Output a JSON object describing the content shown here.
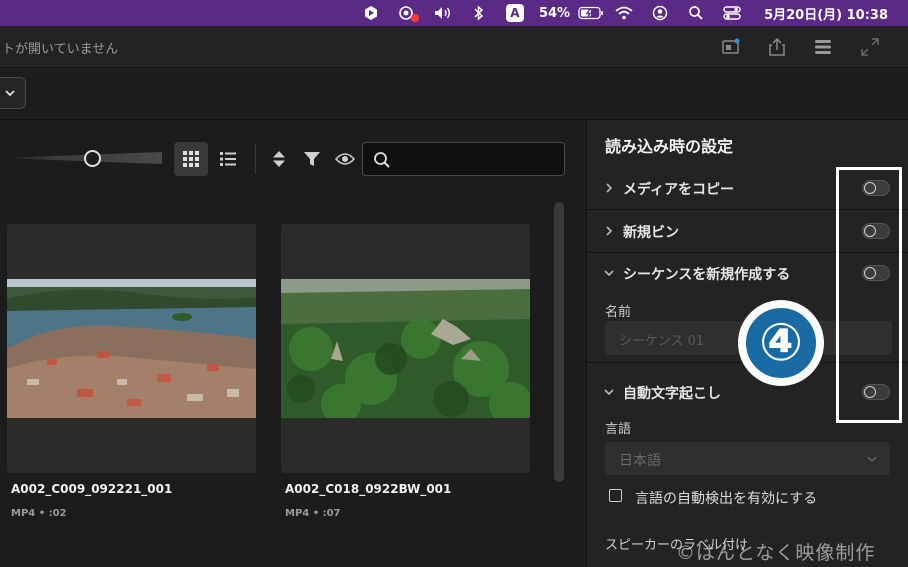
{
  "menubar": {
    "battery": "54%",
    "input_source": "A",
    "datetime": "5月20日(月)  10:38",
    "icons": [
      "app-icon",
      "screen-record-icon",
      "volume-icon",
      "bluetooth-icon",
      "input-source-icon",
      "battery-icon",
      "wifi-icon",
      "user-icon",
      "spotlight-icon",
      "control-center-icon"
    ]
  },
  "titlebar": {
    "title": "トが開いていません"
  },
  "media": {
    "search_placeholder": "",
    "clips": [
      {
        "name": "A002_C009_092221_001",
        "meta": "MP4 • :02"
      },
      {
        "name": "A002_C018_0922BW_001",
        "meta": "MP4 • :07"
      }
    ]
  },
  "panel": {
    "title": "読み込み時の設定",
    "rows": [
      {
        "label": "メディアをコピー",
        "expanded": false,
        "on": false
      },
      {
        "label": "新規ビン",
        "expanded": false,
        "on": false
      },
      {
        "label": "シーケンスを新規作成する",
        "expanded": true,
        "on": false
      },
      {
        "label": "自動文字起こし",
        "expanded": true,
        "on": false
      }
    ],
    "name_label": "名前",
    "name_placeholder": "シーケンス 01",
    "language_label": "言語",
    "language_value": "日本語",
    "auto_detect_label": "言語の自動検出を有効にする",
    "speaker_label": "スピーカーのラベル付け"
  },
  "annotation": {
    "step_number": "④",
    "highlight_color": "#ffffff",
    "badge_color": "#1a6aa3"
  },
  "watermark": "©はんとなく映像制作"
}
